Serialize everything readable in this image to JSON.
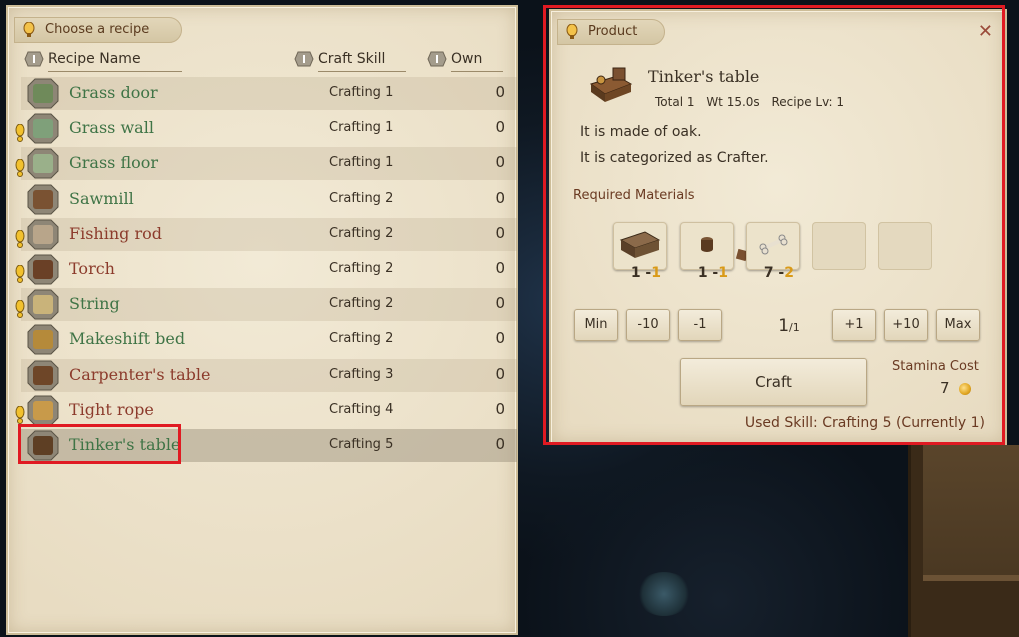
{
  "recipe_panel": {
    "title": "Choose a recipe",
    "columns": {
      "name": "Recipe Name",
      "skill": "Craft Skill",
      "own": "Own"
    },
    "rows": [
      {
        "name": "Grass door",
        "skill": "Crafting 1",
        "own": "0",
        "color": "green",
        "warn": false,
        "icon": "grass-door-icon"
      },
      {
        "name": "Grass wall",
        "skill": "Crafting 1",
        "own": "0",
        "color": "green",
        "warn": true,
        "icon": "grass-wall-icon"
      },
      {
        "name": "Grass floor",
        "skill": "Crafting 1",
        "own": "0",
        "color": "green",
        "warn": true,
        "icon": "grass-floor-icon"
      },
      {
        "name": "Sawmill",
        "skill": "Crafting 2",
        "own": "0",
        "color": "green",
        "warn": false,
        "icon": "sawmill-icon"
      },
      {
        "name": "Fishing rod",
        "skill": "Crafting 2",
        "own": "0",
        "color": "red",
        "warn": true,
        "icon": "fishing-rod-icon"
      },
      {
        "name": "Torch",
        "skill": "Crafting 2",
        "own": "0",
        "color": "red",
        "warn": true,
        "icon": "torch-icon"
      },
      {
        "name": "String",
        "skill": "Crafting 2",
        "own": "0",
        "color": "green",
        "warn": true,
        "icon": "string-icon"
      },
      {
        "name": "Makeshift bed",
        "skill": "Crafting 2",
        "own": "0",
        "color": "green",
        "warn": false,
        "icon": "makeshift-bed-icon"
      },
      {
        "name": "Carpenter's table",
        "skill": "Crafting 3",
        "own": "0",
        "color": "red",
        "warn": false,
        "icon": "carpenters-table-icon"
      },
      {
        "name": "Tight rope",
        "skill": "Crafting 4",
        "own": "0",
        "color": "red",
        "warn": true,
        "icon": "tight-rope-icon"
      },
      {
        "name": "Tinker's table",
        "skill": "Crafting 5",
        "own": "0",
        "color": "green",
        "warn": false,
        "icon": "tinkers-table-icon",
        "selected": true
      }
    ]
  },
  "product_panel": {
    "title": "Product",
    "close": "✕",
    "name": "Tinker's table",
    "total": "Total 1",
    "weight": "Wt 15.0s",
    "recipe_lv": "Recipe Lv: 1",
    "desc1": "It is made of oak.",
    "desc2": "It is categorized as Crafter.",
    "required_label": "Required Materials",
    "materials": [
      {
        "icon": "oak-table-icon",
        "need": "1",
        "have": "1"
      },
      {
        "icon": "wood-block-icon",
        "need": "1",
        "have": "1"
      },
      {
        "icon": "bone-icon",
        "need": "7",
        "have": "2"
      }
    ],
    "buttons": {
      "min": "Min",
      "minus10": "-10",
      "minus1": "-1",
      "plus1": "+1",
      "plus10": "+10",
      "max": "Max"
    },
    "amount": "1",
    "amount_max": "/1",
    "craft": "Craft",
    "stamina_label": "Stamina Cost",
    "stamina_value": "7",
    "used_skill": "Used Skill: Crafting 5 (Currently 1)"
  },
  "colors": {
    "highlight": "#e01a22",
    "green_text": "#3f7446",
    "red_text": "#8c3b2c"
  }
}
